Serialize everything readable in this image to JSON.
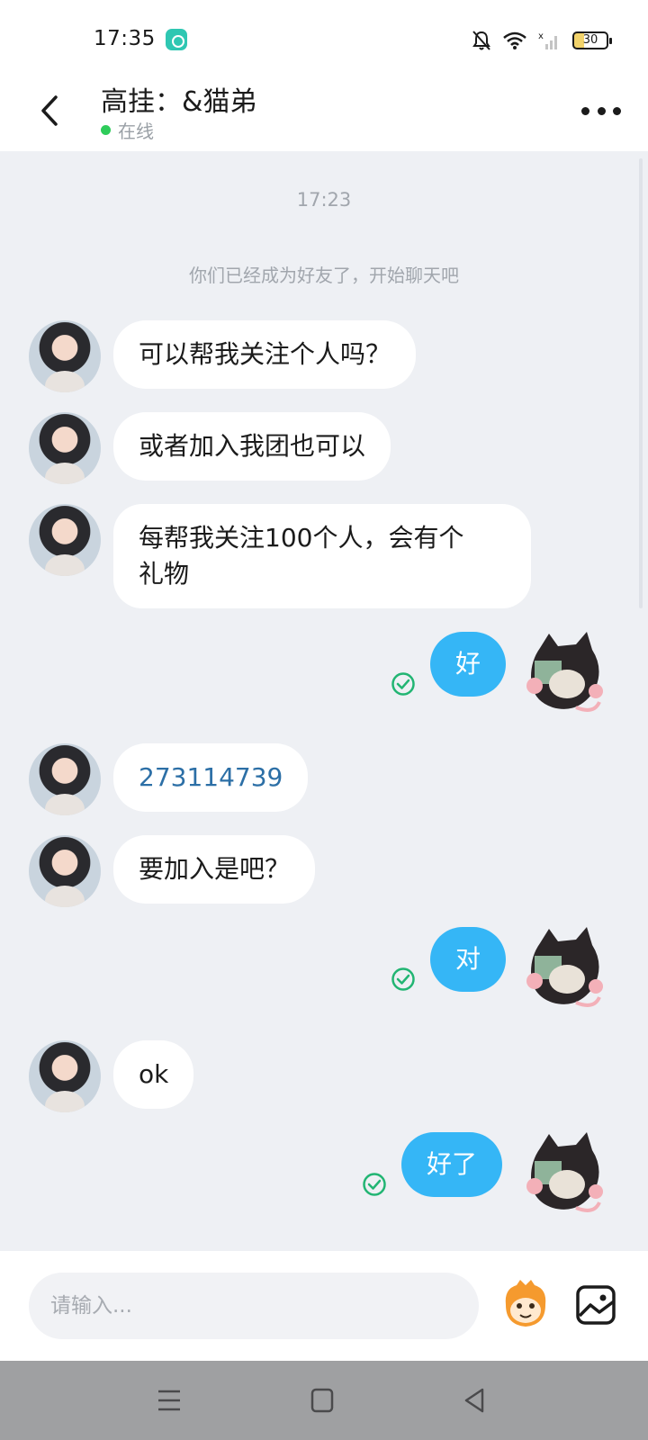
{
  "status_bar": {
    "time": "17:35",
    "battery": "30"
  },
  "header": {
    "title": "高挂：&猫弟",
    "presence": "在线"
  },
  "chat": {
    "timestamp": "17:23",
    "system_note": "你们已经成为好友了，开始聊天吧",
    "messages": [
      {
        "from": "them",
        "text": "可以帮我关注个人吗？"
      },
      {
        "from": "them",
        "text": "或者加入我团也可以"
      },
      {
        "from": "them",
        "line1": "每帮我关注100个人，会有个",
        "line2": "礼物"
      },
      {
        "from": "me",
        "text": "好"
      },
      {
        "from": "them",
        "text": "273114739"
      },
      {
        "from": "them",
        "text": "要加入是吧？"
      },
      {
        "from": "me",
        "text": "对"
      },
      {
        "from": "them",
        "text": "ok"
      },
      {
        "from": "me",
        "text": "好了"
      }
    ]
  },
  "input": {
    "placeholder": "请输入..."
  },
  "colors": {
    "outgoing_bubble": "#35b6f6",
    "incoming_bubble": "#ffffff",
    "online": "#2ecc5a",
    "read_check": "#22b573"
  },
  "icons": [
    "back-arrow-icon",
    "more-dots-icon",
    "read-check-icon",
    "sticker-icon",
    "image-icon",
    "menu-icon",
    "home-icon",
    "back-triangle-icon"
  ]
}
